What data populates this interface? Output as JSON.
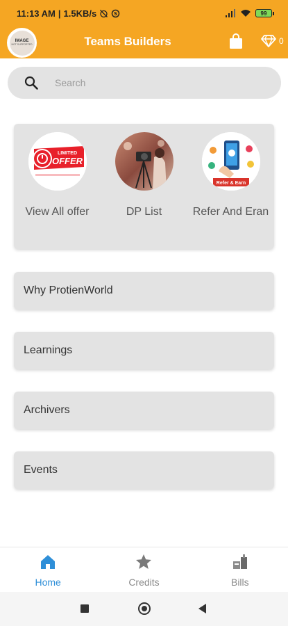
{
  "status_bar": {
    "time": "11:13 AM",
    "speed": "1.5KB/s",
    "battery": "99"
  },
  "app_bar": {
    "title": "Teams Builders",
    "logo_text": "IMAGE",
    "logo_sub": "NOT SUPPORTED",
    "wallet_count": "0"
  },
  "search": {
    "placeholder": "Search"
  },
  "features": [
    {
      "label": "View All offer",
      "image_text_1": "LIMITED",
      "image_text_2": "OFFER"
    },
    {
      "label": "DP List"
    },
    {
      "label": "Refer And Eran",
      "image_text": "Refer & Earn"
    }
  ],
  "menu": [
    {
      "label": "Why ProtienWorld"
    },
    {
      "label": "Learnings"
    },
    {
      "label": "Archivers"
    },
    {
      "label": "Events"
    }
  ],
  "bottom_nav": [
    {
      "label": "Home",
      "active": true
    },
    {
      "label": "Credits",
      "active": false
    },
    {
      "label": "Bills",
      "active": false
    }
  ],
  "colors": {
    "accent": "#f5a623",
    "active": "#2f8fd8",
    "card": "#e3e3e3"
  }
}
